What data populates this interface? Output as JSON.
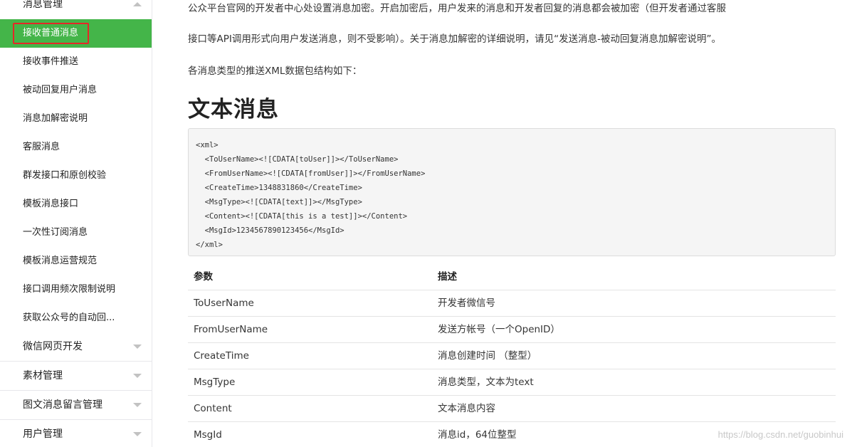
{
  "sidebar": {
    "group_top": "消息管理",
    "items": [
      "接收普通消息",
      "接收事件推送",
      "被动回复用户消息",
      "消息加解密说明",
      "客服消息",
      "群发接口和原创校验",
      "模板消息接口",
      "一次性订阅消息",
      "模板消息运营规范",
      "接口调用频次限制说明",
      "获取公众号的自动回..."
    ],
    "groups_bottom": [
      "微信网页开发",
      "素材管理",
      "图文消息留言管理",
      "用户管理"
    ],
    "active_color": "#44b549",
    "highlight_color": "#e62727"
  },
  "content": {
    "para1": "公众平台官网的开发者中心处设置消息加密。开启加密后，用户发来的消息和开发者回复的消息都会被加密（但开发者通过客服",
    "para2": "接口等API调用形式向用户发送消息，则不受影响）。关于消息加解密的详细说明，请见“发送消息-被动回复消息加解密说明”。",
    "para3": "各消息类型的推送XML数据包结构如下：",
    "heading": "文本消息",
    "code": [
      "<xml>",
      "  <ToUserName><![CDATA[toUser]]></ToUserName>",
      "  <FromUserName><![CDATA[fromUser]]></FromUserName>",
      "  <CreateTime>1348831860</CreateTime>",
      "  <MsgType><![CDATA[text]]></MsgType>",
      "  <Content><![CDATA[this is a test]]></Content>",
      "  <MsgId>1234567890123456</MsgId>",
      "</xml>"
    ],
    "table": {
      "headers": [
        "参数",
        "描述"
      ],
      "rows": [
        [
          "ToUserName",
          "开发者微信号"
        ],
        [
          "FromUserName",
          "发送方帐号（一个OpenID）"
        ],
        [
          "CreateTime",
          "消息创建时间 （整型）"
        ],
        [
          "MsgType",
          "消息类型，文本为text"
        ],
        [
          "Content",
          "文本消息内容"
        ],
        [
          "MsgId",
          "消息id，64位整型"
        ]
      ]
    }
  },
  "watermark": "https://blog.csdn.net/guobinhui"
}
